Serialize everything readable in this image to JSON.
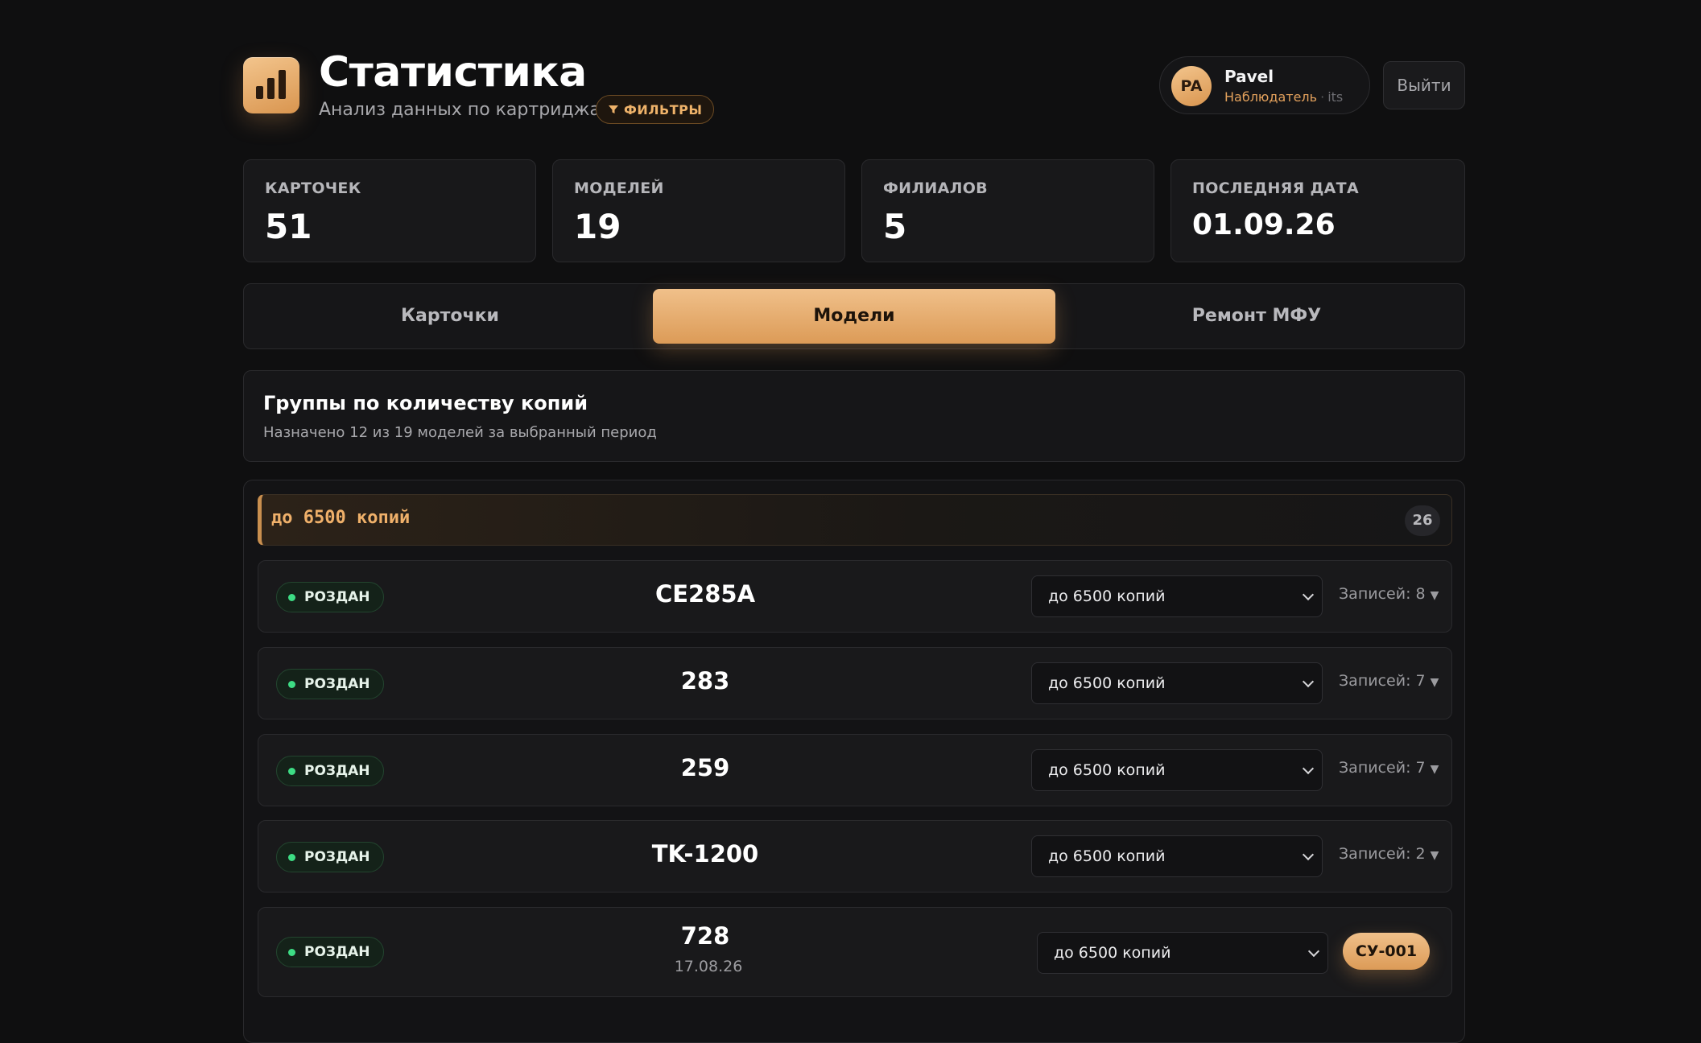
{
  "header": {
    "title": "Статистика",
    "subtitle": "Анализ данных по картриджам",
    "filters_label": "ФИЛЬТРЫ",
    "user": {
      "initials": "PA",
      "name": "Pavel",
      "role": "Наблюдатель",
      "org": "its"
    },
    "logout_label": "Выйти"
  },
  "stats": [
    {
      "label": "КАРТОЧЕК",
      "value": "51"
    },
    {
      "label": "МОДЕЛЕЙ",
      "value": "19"
    },
    {
      "label": "ФИЛИАЛОВ",
      "value": "5"
    },
    {
      "label": "ПОСЛЕДНЯЯ ДАТА",
      "value": "01.09.26"
    }
  ],
  "tabs": [
    {
      "label": "Карточки",
      "active": false
    },
    {
      "label": "Модели",
      "active": true
    },
    {
      "label": "Ремонт МФУ",
      "active": false
    }
  ],
  "section": {
    "title": "Группы по количеству копий",
    "subtitle": "Назначено 12 из 19 моделей за выбранный период"
  },
  "group": {
    "title": "до 6500 копий",
    "count": "26"
  },
  "rows": [
    {
      "status": "РОЗДАН",
      "model": "CE285A",
      "group_value": "до 6500 копий",
      "records": "Записей: 8"
    },
    {
      "status": "РОЗДАН",
      "model": "283",
      "group_value": "до 6500 копий",
      "records": "Записей: 7"
    },
    {
      "status": "РОЗДАН",
      "model": "259",
      "group_value": "до 6500 копий",
      "records": "Записей: 7"
    },
    {
      "status": "РОЗДАН",
      "model": "TK-1200",
      "group_value": "до 6500 копий",
      "records": "Записей: 2"
    },
    {
      "status": "РОЗДАН",
      "model": "728",
      "date": "17.08.26",
      "group_value": "до 6500 копий",
      "action_label": "СУ-001"
    }
  ],
  "colors": {
    "accent": "#dc9b57",
    "background": "#0f0f10",
    "status_green": "#3ddc84"
  }
}
